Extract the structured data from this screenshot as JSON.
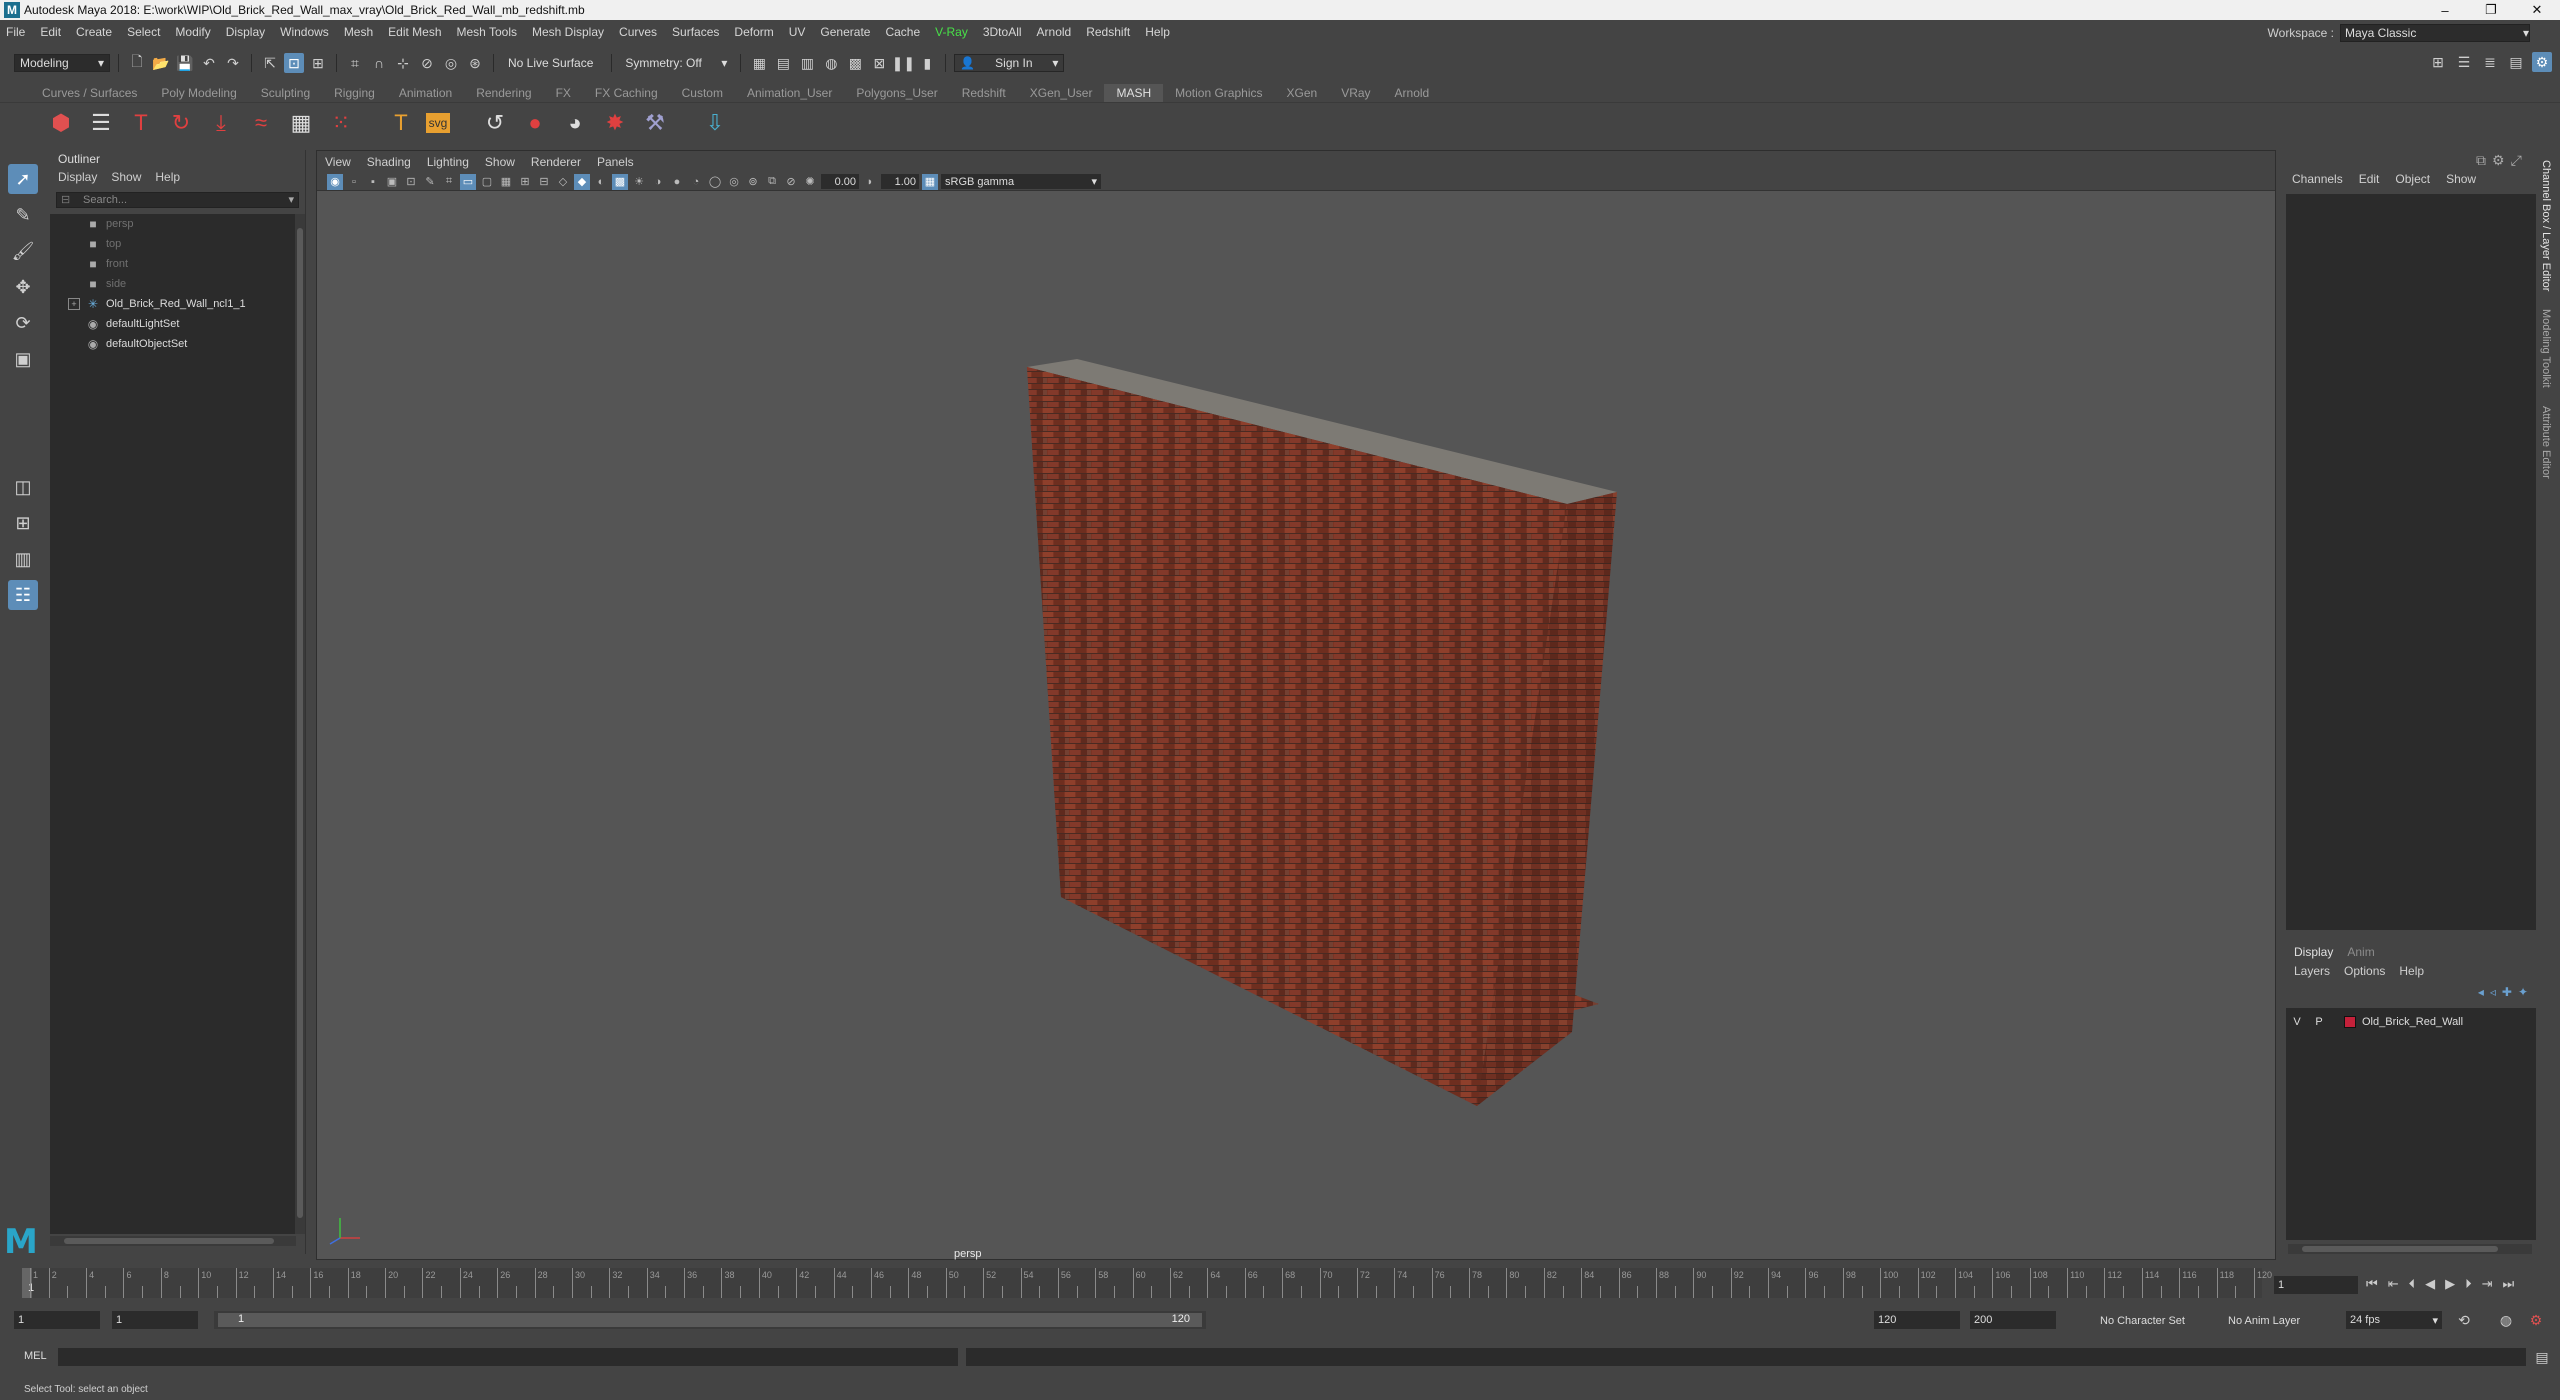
{
  "window": {
    "title": "Autodesk Maya 2018: E:\\work\\WIP\\Old_Brick_Red_Wall_max_vray\\Old_Brick_Red_Wall_mb_redshift.mb",
    "logo": "M"
  },
  "menubar": {
    "items": [
      "File",
      "Edit",
      "Create",
      "Select",
      "Modify",
      "Display",
      "Windows",
      "Mesh",
      "Edit Mesh",
      "Mesh Tools",
      "Mesh Display",
      "Curves",
      "Surfaces",
      "Deform",
      "UV",
      "Generate",
      "Cache",
      "V-Ray",
      "3DtoAll",
      "Arnold",
      "Redshift",
      "Help"
    ],
    "workspace_label": "Workspace :",
    "workspace_value": "Maya Classic"
  },
  "statusline": {
    "mode": "Modeling",
    "live_surface": "No Live Surface",
    "symmetry": "Symmetry: Off",
    "sign_in": "Sign In"
  },
  "shelf": {
    "tabs": [
      "Curves / Surfaces",
      "Poly Modeling",
      "Sculpting",
      "Rigging",
      "Animation",
      "Rendering",
      "FX",
      "FX Caching",
      "Custom",
      "Animation_User",
      "Polygons_User",
      "Redshift",
      "XGen_User",
      "MASH",
      "Motion Graphics",
      "XGen",
      "VRay",
      "Arnold"
    ],
    "active_tab": "MASH",
    "icons": [
      "mash-network-icon",
      "list-icon",
      "text-t-icon",
      "curve-icon",
      "drop-icon",
      "wave-icon",
      "grid-icon",
      "dots-icon",
      "type-icon",
      "svg-icon",
      "refresh-icon",
      "circle-icon",
      "sphere-icon",
      "red-shape-icon",
      "brush-icon",
      "import-icon"
    ]
  },
  "outliner": {
    "title": "Outliner",
    "menu": [
      "Display",
      "Show",
      "Help"
    ],
    "search_placeholder": "Search...",
    "items": [
      {
        "label": "persp",
        "dim": true,
        "icon": "camera-icon"
      },
      {
        "label": "top",
        "dim": true,
        "icon": "camera-icon"
      },
      {
        "label": "front",
        "dim": true,
        "icon": "camera-icon"
      },
      {
        "label": "side",
        "dim": true,
        "icon": "camera-icon"
      },
      {
        "label": "Old_Brick_Red_Wall_ncl1_1",
        "dim": false,
        "icon": "transform-icon",
        "expandable": true
      },
      {
        "label": "defaultLightSet",
        "dim": false,
        "icon": "set-icon"
      },
      {
        "label": "defaultObjectSet",
        "dim": false,
        "icon": "set-icon"
      }
    ]
  },
  "viewport": {
    "menu": [
      "View",
      "Shading",
      "Lighting",
      "Show",
      "Renderer",
      "Panels"
    ],
    "exposure": "0.00",
    "gamma": "1.00",
    "color_management": "sRGB gamma",
    "camera_label": "persp"
  },
  "channelbox": {
    "menu": [
      "Channels",
      "Edit",
      "Object",
      "Show"
    ],
    "side_tabs": [
      "Channel Box / Layer Editor",
      "Modeling Toolkit",
      "Attribute Editor"
    ]
  },
  "layers": {
    "tabs": [
      "Display",
      "Anim"
    ],
    "menu": [
      "Layers",
      "Options",
      "Help"
    ],
    "rows": [
      {
        "v": "V",
        "p": "P",
        "name": "Old_Brick_Red_Wall",
        "color": "#c4213a"
      }
    ]
  },
  "timeline": {
    "ticks": [
      1,
      2,
      4,
      6,
      8,
      10,
      12,
      14,
      16,
      18,
      20,
      22,
      24,
      26,
      28,
      30,
      32,
      34,
      36,
      38,
      40,
      42,
      44,
      46,
      48,
      50,
      52,
      54,
      56,
      58,
      60,
      62,
      64,
      66,
      68,
      70,
      72,
      74,
      76,
      78,
      80,
      82,
      84,
      86,
      88,
      90,
      92,
      94,
      96,
      98,
      100,
      102,
      104,
      106,
      108,
      110,
      112,
      114,
      116,
      118,
      120
    ],
    "current_frame": "1",
    "playhead_label": "1"
  },
  "range": {
    "start": "1",
    "playback_start": "1",
    "slider_start": "1",
    "slider_end": "120",
    "playback_end": "120",
    "end": "200",
    "character_set": "No Character Set",
    "anim_layer": "No Anim Layer",
    "fps": "24 fps"
  },
  "command": {
    "label": "MEL",
    "help": "Select Tool: select an object"
  }
}
